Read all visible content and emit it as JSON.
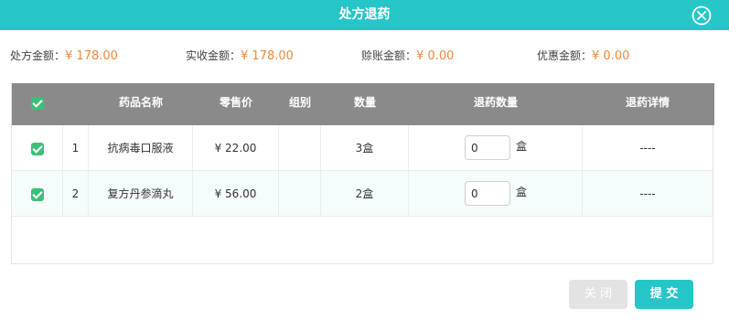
{
  "dialog": {
    "title": "处方退药"
  },
  "summary": [
    {
      "label": "处方金额：",
      "value": "¥ 178.00"
    },
    {
      "label": "实收金额：",
      "value": "¥ 178.00"
    },
    {
      "label": "赊账金额：",
      "value": "¥ 0.00"
    },
    {
      "label": "优惠金额：",
      "value": "¥ 0.00"
    }
  ],
  "table": {
    "headers": [
      "药品名称",
      "零售价",
      "组别",
      "数量",
      "退药数量",
      "退药详情"
    ],
    "rows": [
      {
        "checked": true,
        "index": "1",
        "name": "抗病毒口服液",
        "price": "¥ 22.00",
        "group": "",
        "qty": "3盒",
        "return_qty": "0",
        "unit": "盒",
        "detail": "----"
      },
      {
        "checked": true,
        "index": "2",
        "name": "复方丹参滴丸",
        "price": "¥ 56.00",
        "group": "",
        "qty": "2盒",
        "return_qty": "0",
        "unit": "盒",
        "detail": "----"
      }
    ]
  },
  "buttons": {
    "close": "关 闭",
    "submit": "提 交"
  },
  "colors": {
    "accent": "#26c6c8",
    "amount": "#f0883a",
    "checkbox": "#3dbf7a",
    "header_bg": "#8a8a8a"
  },
  "icons": {
    "close": "close-circle-icon",
    "check": "checkbox-checked-icon"
  }
}
